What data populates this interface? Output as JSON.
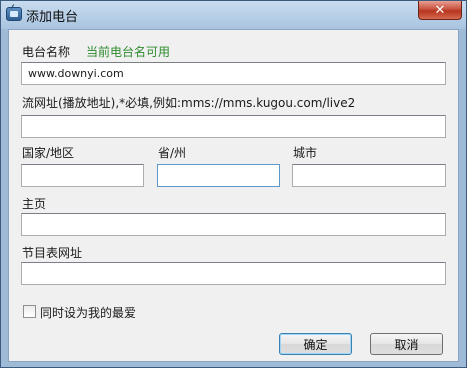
{
  "window": {
    "title": "添加电台",
    "close_glyph": "✕"
  },
  "form": {
    "station_name": {
      "label": "电台名称",
      "status": "当前电台名可用",
      "value": "www.downyi.com"
    },
    "stream_url": {
      "label": "流网址(播放地址),*必填,例如:mms://mms.kugou.com/live2",
      "value": ""
    },
    "country": {
      "label": "国家/地区",
      "value": ""
    },
    "province": {
      "label": "省/州",
      "value": ""
    },
    "city": {
      "label": "城市",
      "value": ""
    },
    "homepage": {
      "label": "主页",
      "value": ""
    },
    "schedule_url": {
      "label": "节目表网址",
      "value": ""
    },
    "favorite_checkbox": {
      "label": "同时设为我的最爱",
      "checked": false
    }
  },
  "buttons": {
    "ok": "确定",
    "cancel": "取消"
  },
  "colors": {
    "status_ok": "#2e8b2e",
    "titlebar": "#b3cbe5",
    "close_button": "#c7533e"
  }
}
